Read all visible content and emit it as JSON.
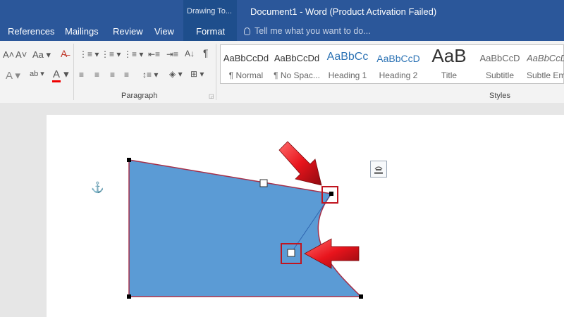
{
  "window": {
    "context_tab_group": "Drawing To...",
    "title": "Document1 - Word (Product Activation Failed)"
  },
  "tabs": [
    {
      "label": "References"
    },
    {
      "label": "Mailings"
    },
    {
      "label": "Review"
    },
    {
      "label": "View"
    },
    {
      "label": "Format"
    }
  ],
  "tell_me": {
    "placeholder": "Tell me what you want to do..."
  },
  "ribbon": {
    "font_case": "Aa",
    "paragraph_label": "Paragraph",
    "styles_label": "Styles",
    "styles": [
      {
        "sample": "AaBbCcDd",
        "name": "¶ Normal"
      },
      {
        "sample": "AaBbCcDd",
        "name": "¶ No Spac..."
      },
      {
        "sample": "AaBbCc",
        "name": "Heading 1"
      },
      {
        "sample": "AaBbCcD",
        "name": "Heading 2"
      },
      {
        "sample": "AaB",
        "name": "Title"
      },
      {
        "sample": "AaBbCcD",
        "name": "Subtitle"
      },
      {
        "sample": "AaBbCcD",
        "name": "Subtle Em"
      }
    ]
  },
  "colors": {
    "title_bar": "#2b579a",
    "shape_fill": "#5b9bd5",
    "shape_outline": "#a5304a",
    "callout_arrow": "#e8141c",
    "callout_box": "#c0151f"
  },
  "icons": [
    "anchor-icon",
    "layout-options-icon",
    "lightbulb-icon",
    "pilcrow-icon",
    "eraser-icon",
    "font-color-icon",
    "shading-icon",
    "borders-icon"
  ]
}
